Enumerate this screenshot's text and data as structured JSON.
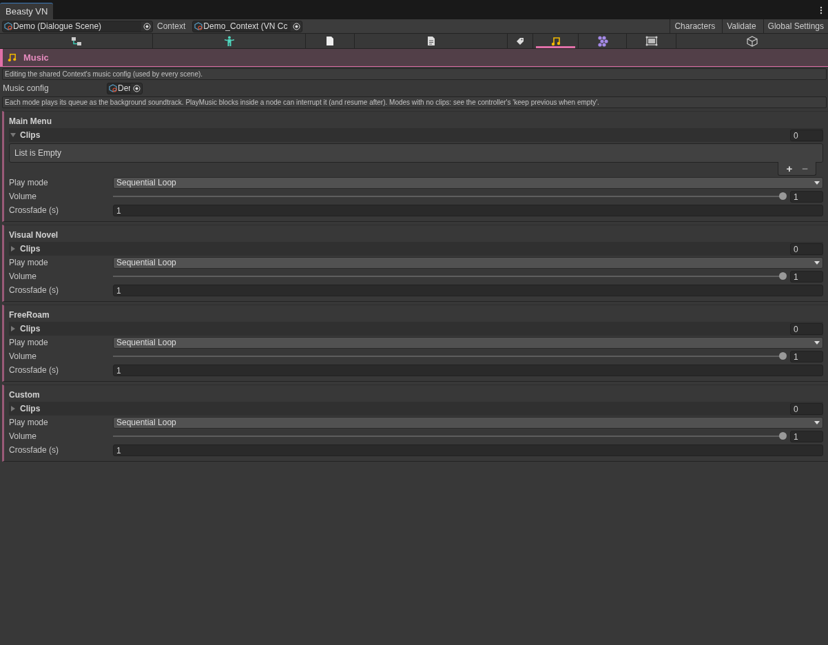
{
  "window": {
    "tab": "Beasty VN"
  },
  "toolbar": {
    "scene_field": "Demo (Dialogue Scene)",
    "context_label": "Context",
    "context_field": "Demo_Context (VN Cc",
    "buttons": [
      "Characters",
      "Validate",
      "Global Settings"
    ]
  },
  "icon_tabs": [
    {
      "selected": false
    },
    {
      "selected": false
    },
    {
      "selected": false
    },
    {
      "selected": false
    },
    {
      "selected": false
    },
    {
      "selected": true
    },
    {
      "selected": false
    },
    {
      "selected": false
    },
    {
      "selected": false
    }
  ],
  "header": {
    "title": "Music"
  },
  "info": "Editing the shared Context's music config (used by every scene).",
  "music_config": {
    "label": "Music config",
    "value": "Der"
  },
  "hint": "Each mode plays its queue as the background soundtrack. PlayMusic blocks inside a node can interrupt it (and resume after). Modes with no clips: see the controller's 'keep previous when empty'.",
  "modes": [
    {
      "title": "Main Menu",
      "clips_label": "Clips",
      "clips_expanded": true,
      "clips_count": "0",
      "empty_text": "List is Empty",
      "add": "+",
      "remove": "−",
      "play_mode_label": "Play mode",
      "play_mode": "Sequential Loop",
      "volume_label": "Volume",
      "volume": {
        "level": 1,
        "reading": "1"
      },
      "crossfade_label": "Crossfade (s)",
      "crossfade": "1"
    },
    {
      "title": "Visual Novel",
      "clips_label": "Clips",
      "clips_expanded": false,
      "clips_count": "0",
      "play_mode_label": "Play mode",
      "play_mode": "Sequential Loop",
      "volume_label": "Volume",
      "volume": {
        "level": 1,
        "reading": "1"
      },
      "crossfade_label": "Crossfade (s)",
      "crossfade": "1"
    },
    {
      "title": "FreeRoam",
      "clips_label": "Clips",
      "clips_expanded": false,
      "clips_count": "0",
      "play_mode_label": "Play mode",
      "play_mode": "Sequential Loop",
      "volume_label": "Volume",
      "volume": {
        "level": 1,
        "reading": "1"
      },
      "crossfade_label": "Crossfade (s)",
      "crossfade": "1"
    },
    {
      "title": "Custom",
      "clips_label": "Clips",
      "clips_expanded": false,
      "clips_count": "0",
      "play_mode_label": "Play mode",
      "play_mode": "Sequential Loop",
      "volume_label": "Volume",
      "volume": {
        "level": 1,
        "reading": "1"
      },
      "crossfade_label": "Crossfade (s)",
      "crossfade": "1"
    }
  ]
}
